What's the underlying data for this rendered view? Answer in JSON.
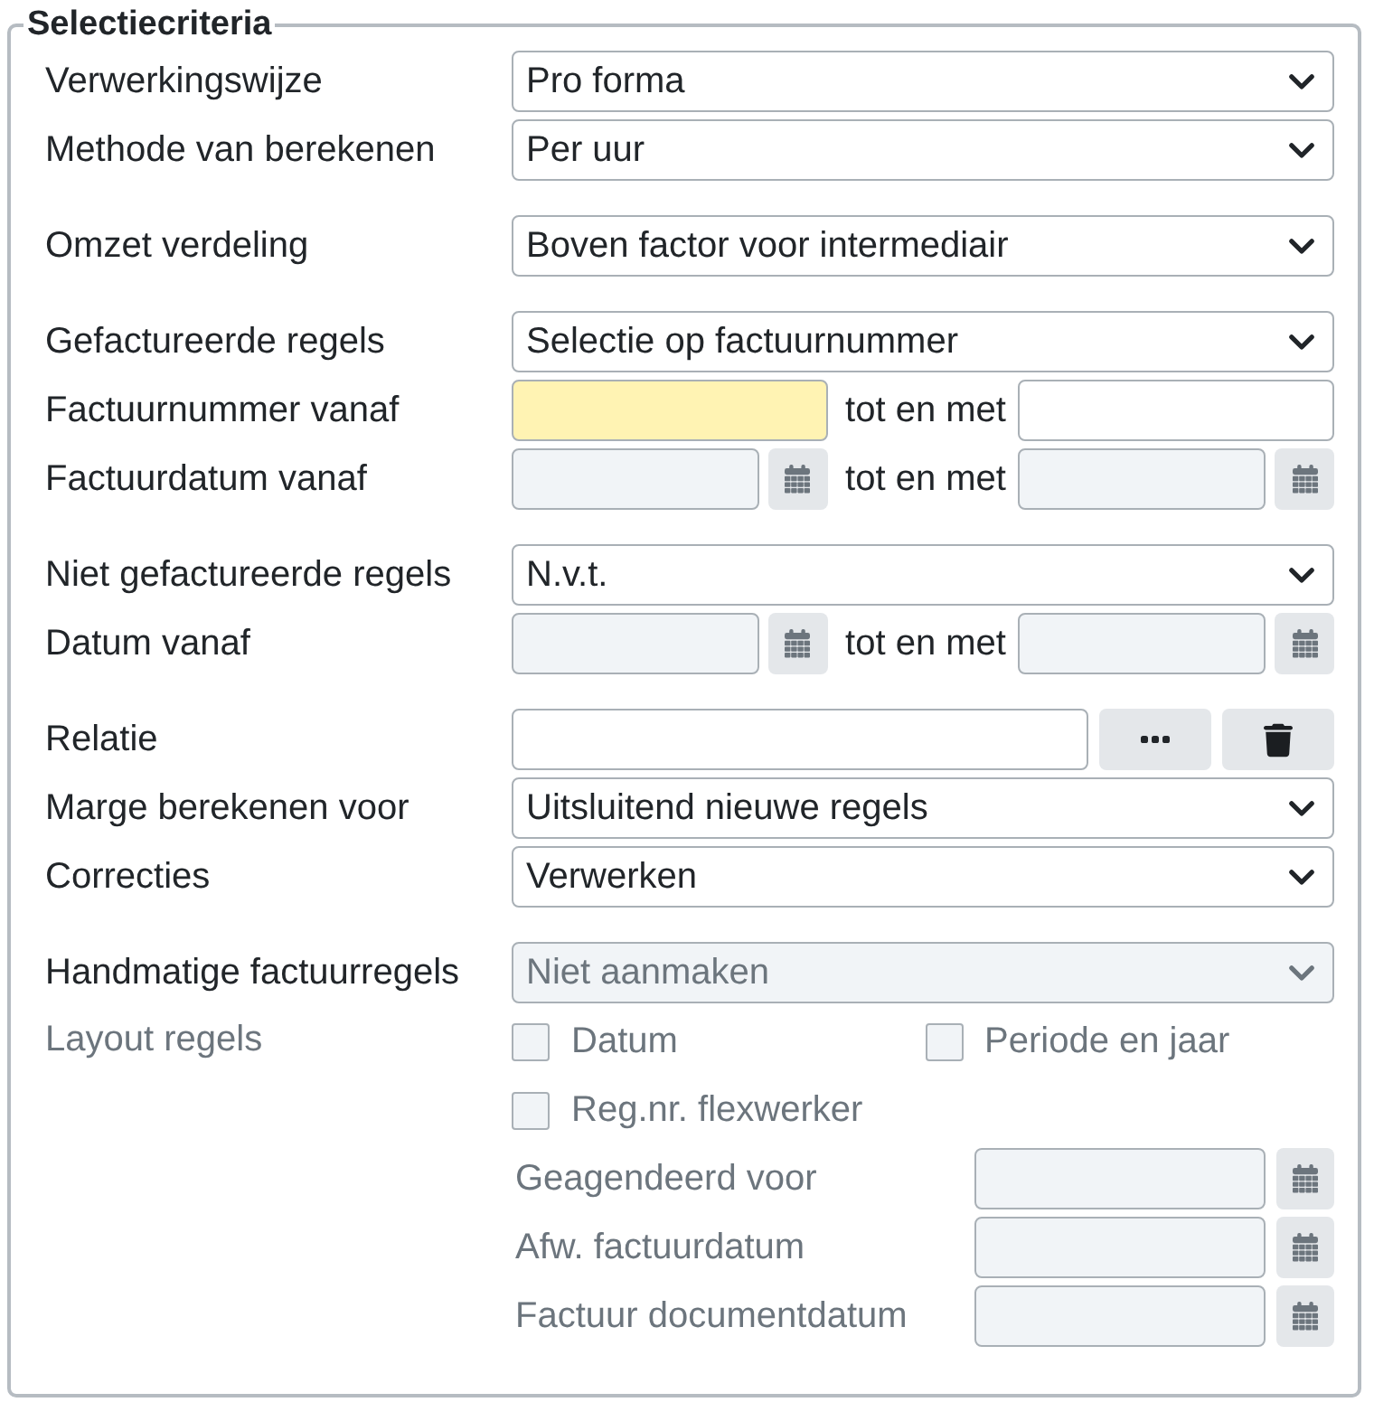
{
  "panel": {
    "legend": "Selectiecriteria"
  },
  "groups": [
    {
      "rows": [
        {
          "kind": "select",
          "label": "Verwerkingswijze",
          "value": "Pro forma",
          "disabled": false
        },
        {
          "kind": "select",
          "label": "Methode van berekenen",
          "value": "Per uur",
          "disabled": false
        }
      ]
    },
    {
      "rows": [
        {
          "kind": "select",
          "label": "Omzet verdeling",
          "value": "Boven factor voor intermediair",
          "disabled": false
        }
      ]
    },
    {
      "rows": [
        {
          "kind": "select",
          "label": "Gefactureerde regels",
          "value": "Selectie op factuurnummer",
          "disabled": false
        },
        {
          "kind": "text-range",
          "label": "Factuurnummer vanaf",
          "separator": "tot en met",
          "from": {
            "highlighted": true
          },
          "to": {
            "highlighted": false
          }
        },
        {
          "kind": "date-range",
          "label": "Factuurdatum vanaf",
          "separator": "tot en met",
          "from": {
            "disabled": true
          },
          "to": {
            "disabled": true
          }
        }
      ]
    },
    {
      "rows": [
        {
          "kind": "select",
          "label": "Niet gefactureerde regels",
          "value": "N.v.t.",
          "disabled": false
        },
        {
          "kind": "date-range",
          "label": "Datum vanaf",
          "separator": "tot en met",
          "from": {
            "disabled": true
          },
          "to": {
            "disabled": true
          }
        }
      ]
    },
    {
      "rows": [
        {
          "kind": "lookup",
          "label": "Relatie"
        },
        {
          "kind": "select",
          "label": "Marge berekenen voor",
          "value": "Uitsluitend nieuwe regels",
          "disabled": false
        },
        {
          "kind": "select",
          "label": "Correcties",
          "value": "Verwerken",
          "disabled": false
        }
      ]
    },
    {
      "rows": [
        {
          "kind": "select",
          "label": "Handmatige factuurregels",
          "value": "Niet aanmaken",
          "disabled": true
        },
        {
          "kind": "checkboxes",
          "label": "Layout regels",
          "disabled": true,
          "options": [
            {
              "label": "Datum",
              "checked": false
            },
            {
              "label": "Periode en jaar",
              "checked": false
            },
            {
              "label": "Reg.nr. flexwerker",
              "checked": false
            }
          ]
        },
        {
          "kind": "date",
          "label": "Geagendeerd voor",
          "disabled": true
        },
        {
          "kind": "date",
          "label": "Afw. factuurdatum",
          "disabled": true
        },
        {
          "kind": "date",
          "label": "Factuur documentdatum",
          "disabled": true
        }
      ]
    }
  ]
}
